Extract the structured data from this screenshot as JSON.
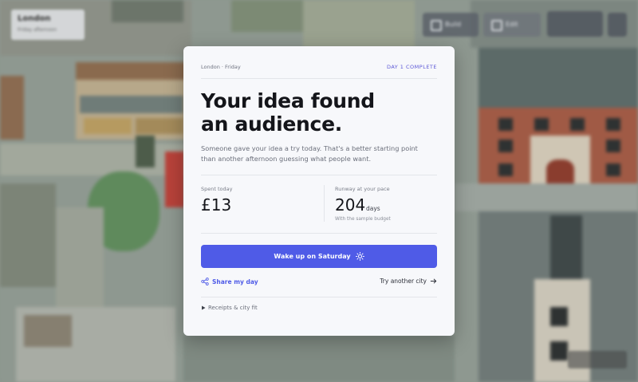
{
  "hud": {
    "city_name": "London",
    "city_sub": "Friday afternoon",
    "btn_1": "Build",
    "btn_2": "Edit"
  },
  "card": {
    "location": "London · Friday",
    "status": "DAY 1 COMPLETE",
    "headline_line1": "Your idea found",
    "headline_line2": "an audience.",
    "subtitle": "Someone gave your idea a try today. That's a better starting point than another afternoon guessing what people want.",
    "stats": {
      "spent_label": "Spent today",
      "spent_value": "£13",
      "runway_label": "Runway at your pace",
      "runway_value": "204",
      "runway_unit": "days",
      "runway_note": "With the sample budget"
    },
    "cta_label": "Wake up on Saturday",
    "share_label": "Share my day",
    "another_label": "Try another city",
    "receipts_label": "Receipts & city fit"
  },
  "icons": {
    "cta": "sun-icon",
    "share": "share-icon",
    "another": "arrow-right-icon",
    "receipts": "triangle-right-icon"
  },
  "colors": {
    "accent": "#4f5be7",
    "status": "#5b57d6",
    "card_bg": "#f7f8fb"
  }
}
